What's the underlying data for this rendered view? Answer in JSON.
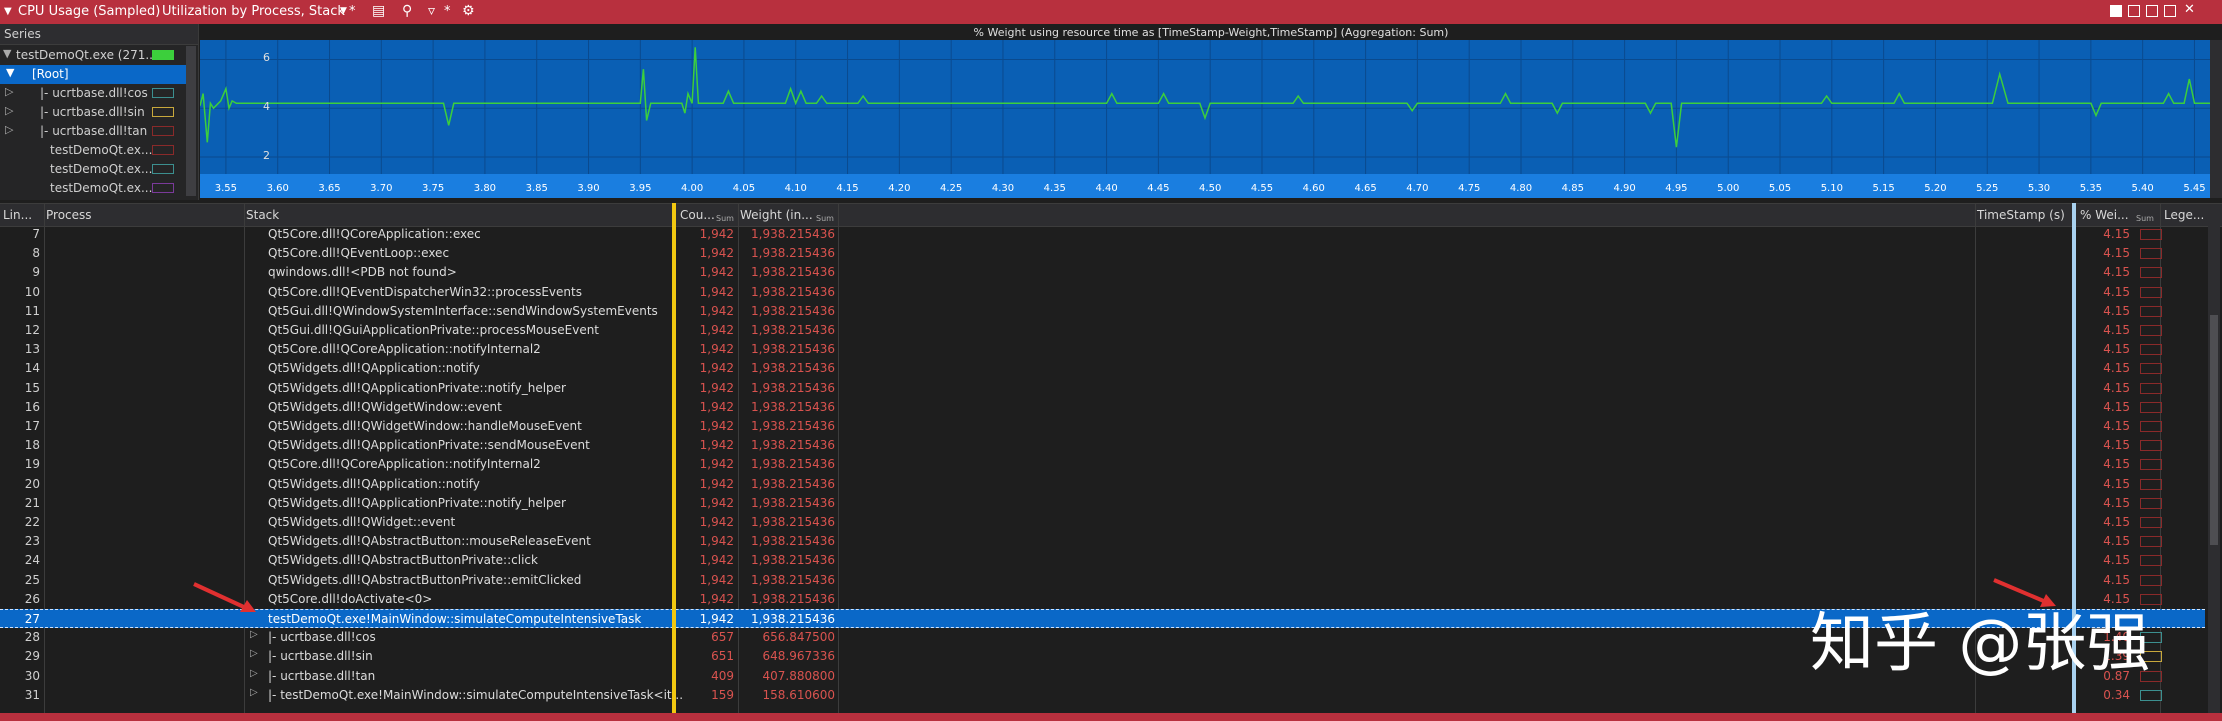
{
  "title_bar": {
    "graph_name": "CPU Usage (Sampled)",
    "preset": "Utilization by Process, Stack *",
    "filter_label": "*"
  },
  "series": {
    "header": "Series",
    "items": [
      {
        "label": "testDemoQt.exe (271...",
        "swatch": "#3ccf3c"
      },
      {
        "label": "[Root]"
      },
      {
        "label": "|- ucrtbase.dll!cos",
        "swatch": "#3c8f8f"
      },
      {
        "label": "|- ucrtbase.dll!sin",
        "swatch": "#c8a83c"
      },
      {
        "label": "|- ucrtbase.dll!tan",
        "swatch": "#8a2a2a"
      },
      {
        "label": "testDemoQt.ex...",
        "swatch": "#8a2a2a"
      },
      {
        "label": "testDemoQt.ex...",
        "swatch": "#3c8f8f"
      },
      {
        "label": "testDemoQt.ex...",
        "swatch": "#7a3a9a"
      }
    ]
  },
  "chart_data": {
    "type": "line",
    "title": "% Weight using resource time as [TimeStamp-Weight,TimeStamp] (Aggregation: Sum)",
    "xlim": [
      3.525,
      5.465
    ],
    "ylim": [
      1.3,
      6.8
    ],
    "y_ticks": [
      "2",
      "4",
      "6"
    ],
    "x_ticks": [
      "3.55",
      "3.60",
      "3.65",
      "3.70",
      "3.75",
      "3.80",
      "3.85",
      "3.90",
      "3.95",
      "4.00",
      "4.05",
      "4.10",
      "4.15",
      "4.20",
      "4.25",
      "4.30",
      "4.35",
      "4.40",
      "4.45",
      "4.50",
      "4.55",
      "4.60",
      "4.65",
      "4.70",
      "4.75",
      "4.80",
      "4.85",
      "4.90",
      "4.95",
      "5.00",
      "5.05",
      "5.10",
      "5.15",
      "5.20",
      "5.25",
      "5.30",
      "5.35",
      "5.40",
      "5.45"
    ],
    "series": [
      {
        "color": "#3ccf3c",
        "x": [
          3.525,
          3.528,
          3.532,
          3.535,
          3.538,
          3.545,
          3.55,
          3.553,
          3.556,
          3.56,
          3.6,
          3.76,
          3.765,
          3.77,
          3.95,
          3.953,
          3.956,
          3.96,
          3.99,
          3.993,
          3.996,
          4.0,
          4.003,
          4.006,
          4.01,
          4.02,
          4.03,
          4.035,
          4.04,
          4.09,
          4.095,
          4.1,
          4.105,
          4.11,
          4.12,
          4.125,
          4.13,
          4.16,
          4.165,
          4.17,
          4.19,
          4.4,
          4.405,
          4.41,
          4.45,
          4.455,
          4.46,
          4.49,
          4.495,
          4.5,
          4.58,
          4.585,
          4.59,
          4.69,
          4.695,
          4.7,
          4.78,
          4.785,
          4.79,
          4.83,
          4.835,
          4.84,
          4.92,
          4.925,
          4.93,
          4.945,
          4.95,
          4.955,
          4.96,
          5.09,
          5.095,
          5.1,
          5.16,
          5.165,
          5.17,
          5.255,
          5.262,
          5.27,
          5.35,
          5.355,
          5.36,
          5.42,
          5.425,
          5.43,
          5.44,
          5.445,
          5.45,
          5.465
        ],
        "y": [
          4.1,
          4.6,
          2.6,
          4.2,
          4.0,
          4.3,
          4.8,
          4.0,
          4.3,
          4.2,
          4.2,
          4.2,
          3.3,
          4.2,
          4.2,
          5.6,
          3.5,
          4.2,
          4.2,
          3.8,
          4.6,
          4.2,
          6.5,
          4.2,
          4.2,
          4.2,
          4.2,
          4.7,
          4.2,
          4.2,
          4.8,
          4.2,
          4.7,
          4.2,
          4.2,
          4.5,
          4.2,
          4.2,
          4.5,
          4.2,
          4.2,
          4.2,
          4.6,
          4.2,
          4.2,
          4.6,
          4.2,
          4.2,
          3.6,
          4.2,
          4.2,
          4.5,
          4.2,
          4.2,
          3.9,
          4.2,
          4.2,
          4.6,
          4.2,
          4.2,
          3.8,
          4.2,
          4.2,
          3.8,
          4.2,
          4.2,
          2.4,
          4.2,
          4.2,
          4.2,
          4.5,
          4.2,
          4.2,
          4.6,
          4.2,
          4.2,
          5.4,
          4.2,
          4.2,
          3.7,
          4.2,
          4.2,
          4.6,
          4.2,
          4.2,
          5.2,
          4.2,
          4.2
        ]
      }
    ]
  },
  "table": {
    "columns": {
      "line": "Lin...",
      "process": "Process",
      "stack": "Stack",
      "count": "Cou...",
      "count_sub": "Sum",
      "weight": "Weight (in...",
      "weight_sub": "Sum",
      "timestamp": "TimeStamp (s)",
      "pct": "% Wei...",
      "pct_sub": "Sum",
      "legend": "Lege..."
    },
    "rows": [
      {
        "ln": "7",
        "stack": "Qt5Core.dll!QCoreApplication::exec",
        "count": "1,942",
        "weight": "1,938.215436",
        "pct": "4.15",
        "indent": 1
      },
      {
        "ln": "8",
        "stack": "Qt5Core.dll!QEventLoop::exec",
        "count": "1,942",
        "weight": "1,938.215436",
        "pct": "4.15",
        "indent": 1
      },
      {
        "ln": "9",
        "stack": "qwindows.dll!<PDB not found>",
        "count": "1,942",
        "weight": "1,938.215436",
        "pct": "4.15",
        "indent": 1
      },
      {
        "ln": "10",
        "stack": "Qt5Core.dll!QEventDispatcherWin32::processEvents",
        "count": "1,942",
        "weight": "1,938.215436",
        "pct": "4.15",
        "indent": 1
      },
      {
        "ln": "11",
        "stack": "Qt5Gui.dll!QWindowSystemInterface::sendWindowSystemEvents",
        "count": "1,942",
        "weight": "1,938.215436",
        "pct": "4.15",
        "indent": 1
      },
      {
        "ln": "12",
        "stack": "Qt5Gui.dll!QGuiApplicationPrivate::processMouseEvent",
        "count": "1,942",
        "weight": "1,938.215436",
        "pct": "4.15",
        "indent": 1
      },
      {
        "ln": "13",
        "stack": "Qt5Core.dll!QCoreApplication::notifyInternal2",
        "count": "1,942",
        "weight": "1,938.215436",
        "pct": "4.15",
        "indent": 1
      },
      {
        "ln": "14",
        "stack": "Qt5Widgets.dll!QApplication::notify",
        "count": "1,942",
        "weight": "1,938.215436",
        "pct": "4.15",
        "indent": 1
      },
      {
        "ln": "15",
        "stack": "Qt5Widgets.dll!QApplicationPrivate::notify_helper",
        "count": "1,942",
        "weight": "1,938.215436",
        "pct": "4.15",
        "indent": 1
      },
      {
        "ln": "16",
        "stack": "Qt5Widgets.dll!QWidgetWindow::event",
        "count": "1,942",
        "weight": "1,938.215436",
        "pct": "4.15",
        "indent": 1
      },
      {
        "ln": "17",
        "stack": "Qt5Widgets.dll!QWidgetWindow::handleMouseEvent",
        "count": "1,942",
        "weight": "1,938.215436",
        "pct": "4.15",
        "indent": 1
      },
      {
        "ln": "18",
        "stack": "Qt5Widgets.dll!QApplicationPrivate::sendMouseEvent",
        "count": "1,942",
        "weight": "1,938.215436",
        "pct": "4.15",
        "indent": 1
      },
      {
        "ln": "19",
        "stack": "Qt5Core.dll!QCoreApplication::notifyInternal2",
        "count": "1,942",
        "weight": "1,938.215436",
        "pct": "4.15",
        "indent": 1
      },
      {
        "ln": "20",
        "stack": "Qt5Widgets.dll!QApplication::notify",
        "count": "1,942",
        "weight": "1,938.215436",
        "pct": "4.15",
        "indent": 1
      },
      {
        "ln": "21",
        "stack": "Qt5Widgets.dll!QApplicationPrivate::notify_helper",
        "count": "1,942",
        "weight": "1,938.215436",
        "pct": "4.15",
        "indent": 1
      },
      {
        "ln": "22",
        "stack": "Qt5Widgets.dll!QWidget::event",
        "count": "1,942",
        "weight": "1,938.215436",
        "pct": "4.15",
        "indent": 1
      },
      {
        "ln": "23",
        "stack": "Qt5Widgets.dll!QAbstractButton::mouseReleaseEvent",
        "count": "1,942",
        "weight": "1,938.215436",
        "pct": "4.15",
        "indent": 1
      },
      {
        "ln": "24",
        "stack": "Qt5Widgets.dll!QAbstractButtonPrivate::click",
        "count": "1,942",
        "weight": "1,938.215436",
        "pct": "4.15",
        "indent": 1
      },
      {
        "ln": "25",
        "stack": "Qt5Widgets.dll!QAbstractButtonPrivate::emitClicked",
        "count": "1,942",
        "weight": "1,938.215436",
        "pct": "4.15",
        "indent": 1
      },
      {
        "ln": "26",
        "stack": "Qt5Core.dll!doActivate<0>",
        "count": "1,942",
        "weight": "1,938.215436",
        "pct": "4.15",
        "indent": 1
      },
      {
        "ln": "27",
        "stack": "testDemoQt.exe!MainWindow::simulateComputeIntensiveTask",
        "count": "1,942",
        "weight": "1,938.215436",
        "pct": "4.15",
        "indent": 1,
        "selected": true
      },
      {
        "ln": "28",
        "stack": "|- ucrtbase.dll!cos",
        "count": "657",
        "weight": "656.847500",
        "pct": "1.40",
        "indent": 2,
        "legend_color": "#3c8f8f"
      },
      {
        "ln": "29",
        "stack": "|- ucrtbase.dll!sin",
        "count": "651",
        "weight": "648.967336",
        "pct": "1.39",
        "indent": 2,
        "legend_color": "#c8a83c"
      },
      {
        "ln": "30",
        "stack": "|- ucrtbase.dll!tan",
        "count": "409",
        "weight": "407.880800",
        "pct": "0.87",
        "indent": 2,
        "legend_color": "#8a2a2a"
      },
      {
        "ln": "31",
        "stack": "|- testDemoQt.exe!MainWindow::simulateComputeIntensiveTask<it...",
        "count": "159",
        "weight": "158.610600",
        "pct": "0.34",
        "indent": 2,
        "legend_color": "#3c8f8f"
      }
    ]
  },
  "watermark": "知乎 @张强",
  "colors": {
    "accent_red": "#b8303e",
    "selection": "#0a68c8",
    "chart_bg": "#0a5fb4",
    "value_red": "#d9534f",
    "yellow_divider": "#f2c811"
  }
}
